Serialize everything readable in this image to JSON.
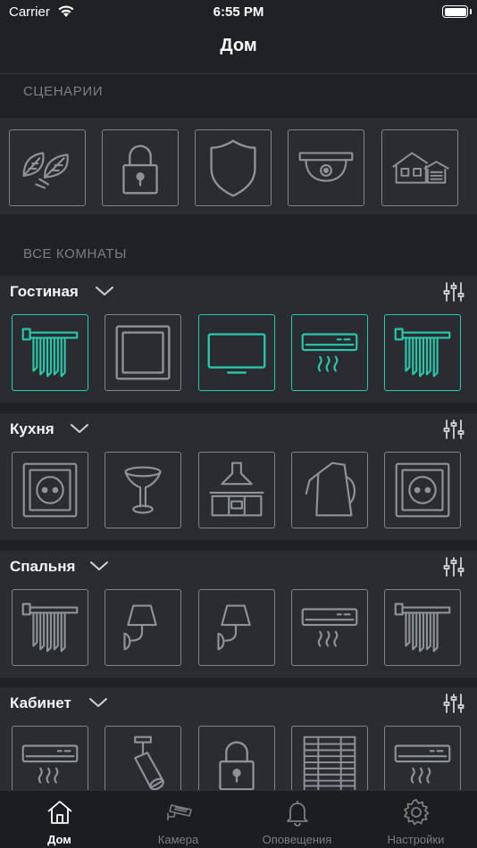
{
  "status_bar": {
    "carrier": "Carrier",
    "time": "6:55 PM"
  },
  "nav": {
    "title": "Дом"
  },
  "scenarios": {
    "label": "СЦЕНАРИИ",
    "items": [
      "leaves-icon",
      "padlock-icon",
      "shield-icon",
      "dome-camera-icon",
      "house-garage-icon"
    ]
  },
  "all_rooms": {
    "label": "ВСЕ КОМНАТЫ"
  },
  "rooms": [
    {
      "name": "Гостиная",
      "devices": [
        {
          "icon": "curtains-icon",
          "active": true
        },
        {
          "icon": "wall-switch-icon",
          "active": false
        },
        {
          "icon": "tv-icon",
          "active": true
        },
        {
          "icon": "air-conditioner-icon",
          "active": true
        },
        {
          "icon": "curtains-icon",
          "active": true
        }
      ]
    },
    {
      "name": "Кухня",
      "devices": [
        {
          "icon": "socket-icon",
          "active": false
        },
        {
          "icon": "table-lamp-icon",
          "active": false
        },
        {
          "icon": "kitchen-hood-icon",
          "active": false
        },
        {
          "icon": "kettle-icon",
          "active": false
        },
        {
          "icon": "socket-icon",
          "active": false
        }
      ]
    },
    {
      "name": "Спальня",
      "devices": [
        {
          "icon": "curtains-icon",
          "active": false
        },
        {
          "icon": "wall-lamp-icon",
          "active": false
        },
        {
          "icon": "wall-lamp-icon",
          "active": false
        },
        {
          "icon": "air-conditioner-icon",
          "active": false
        },
        {
          "icon": "curtains-icon",
          "active": false
        }
      ]
    },
    {
      "name": "Кабинет",
      "devices": [
        {
          "icon": "air-conditioner-icon",
          "active": false
        },
        {
          "icon": "spotlight-icon",
          "active": false
        },
        {
          "icon": "padlock-icon",
          "active": false
        },
        {
          "icon": "blinds-icon",
          "active": false
        },
        {
          "icon": "air-conditioner-icon",
          "active": false
        }
      ]
    }
  ],
  "tabs": [
    {
      "label": "Дом",
      "icon": "home-icon",
      "active": true
    },
    {
      "label": "Камера",
      "icon": "security-camera-icon",
      "active": false
    },
    {
      "label": "Оповещения",
      "icon": "bell-icon",
      "active": false
    },
    {
      "label": "Настройки",
      "icon": "gear-icon",
      "active": false
    }
  ],
  "colors": {
    "accent": "#27c9ab",
    "tile_border": "#7f838b",
    "background": "#1f2126",
    "panel": "#2a2c32"
  }
}
